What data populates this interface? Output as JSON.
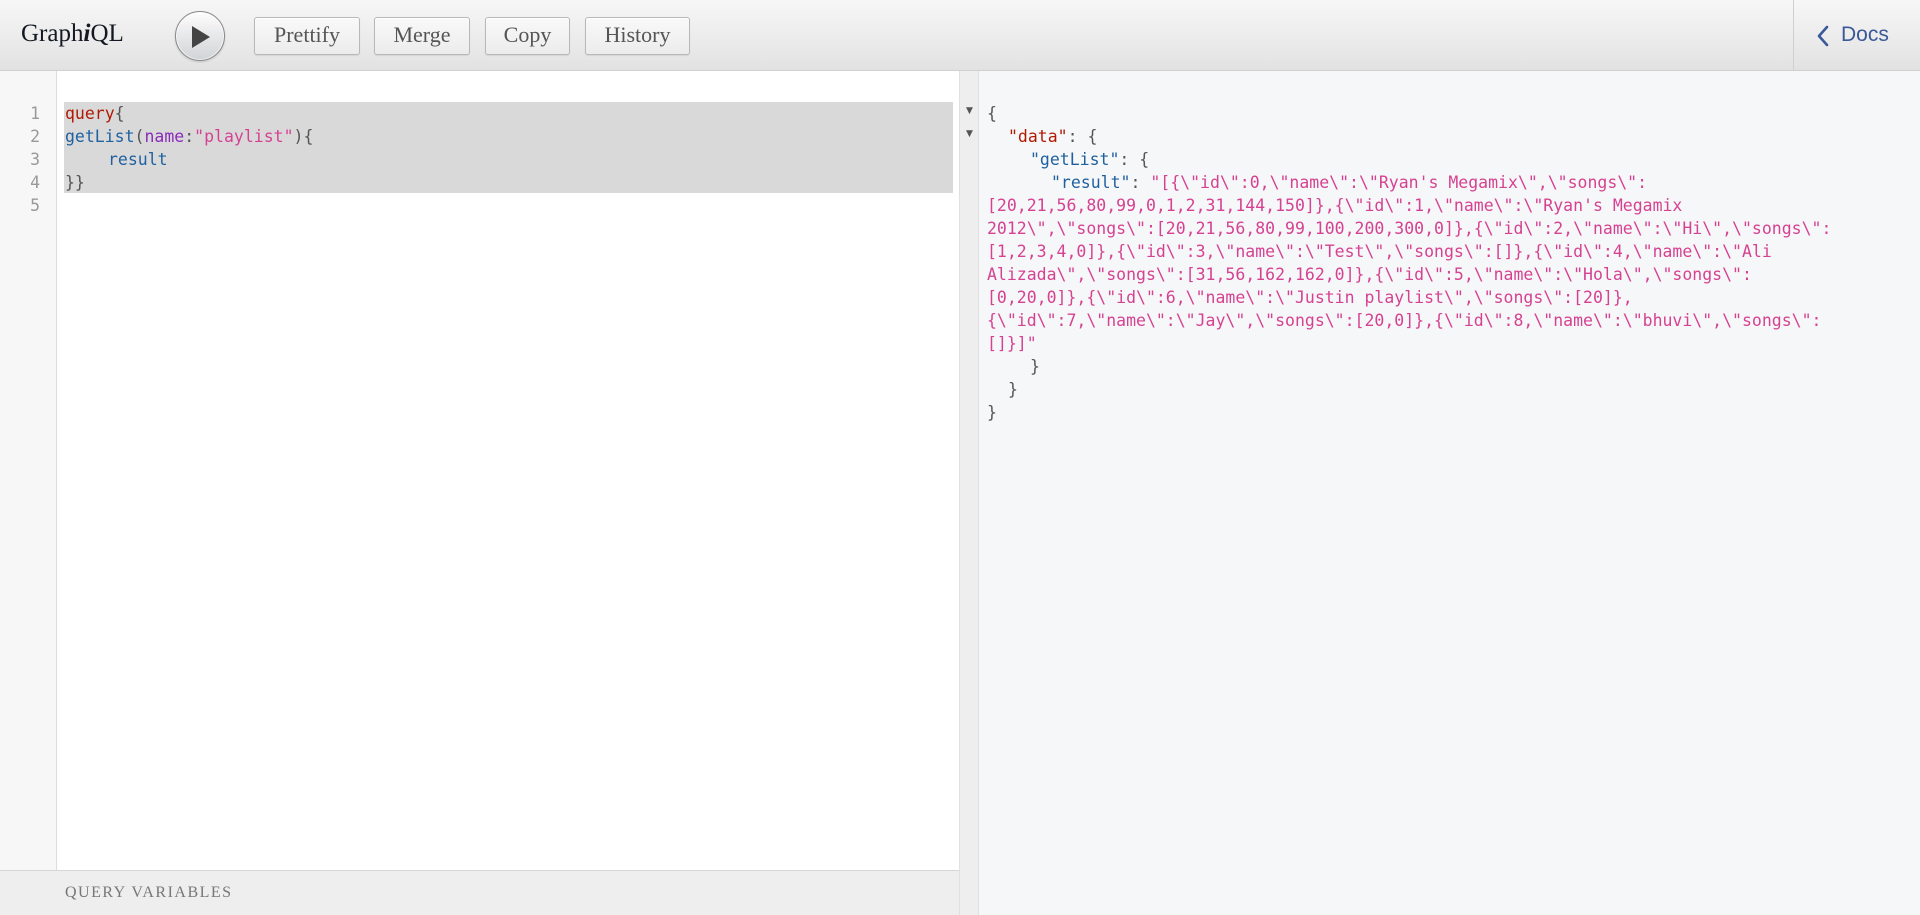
{
  "toolbar": {
    "title_prefix": "Graph",
    "title_italic": "i",
    "title_suffix": "QL",
    "buttons": [
      "Prettify",
      "Merge",
      "Copy",
      "History"
    ],
    "docs_label": "Docs"
  },
  "editor": {
    "line_numbers": [
      "1",
      "2",
      "3",
      "4",
      "5"
    ],
    "line1": {
      "keyword": "query",
      "brace": "{"
    },
    "line2": {
      "field": "getList",
      "open_paren": "(",
      "arg": "name",
      "colon": ":",
      "string": "\"playlist\"",
      "close": "){"
    },
    "line3": {
      "field": "result"
    },
    "line4": {
      "brace": "}}"
    }
  },
  "variables": {
    "title": "Query Variables"
  },
  "result": {
    "open_brace": "{",
    "data_key": "\"data\"",
    "getlist_key": "\"getList\"",
    "result_key": "\"result\"",
    "value_lines": [
      "\"[{\\\"id\\\":0,\\\"name\\\":\\\"Ryan's Megamix\\\",\\\"songs\\\":",
      "[20,21,56,80,99,0,1,2,31,144,150]},{\\\"id\\\":1,\\\"name\\\":\\\"Ryan's Megamix",
      "2012\\\",\\\"songs\\\":[20,21,56,80,99,100,200,300,0]},{\\\"id\\\":2,\\\"name\\\":\\\"Hi\\\",\\\"songs\\\":",
      "[1,2,3,4,0]},{\\\"id\\\":3,\\\"name\\\":\\\"Test\\\",\\\"songs\\\":[]},{\\\"id\\\":4,\\\"name\\\":\\\"Ali",
      "Alizada\\\",\\\"songs\\\":[31,56,162,162,0]},{\\\"id\\\":5,\\\"name\\\":\\\"Hola\\\",\\\"songs\\\":",
      "[0,20,0]},{\\\"id\\\":6,\\\"name\\\":\\\"Justin playlist\\\",\\\"songs\\\":[20]},",
      "{\\\"id\\\":7,\\\"name\\\":\\\"Jay\\\",\\\"songs\\\":[20,0]},{\\\"id\\\":8,\\\"name\\\":\\\"bhuvi\\\",\\\"songs\\\":",
      "[]}]\""
    ],
    "close_getlist": "}",
    "close_data": "}",
    "close_root": "}"
  },
  "colors": {
    "keyword": "#b11a04",
    "field": "#1f61a0",
    "argument": "#8b2bb9",
    "string": "#d64292",
    "docs_link": "#3b5998"
  },
  "icons": {
    "execute": "play-icon",
    "docs": "chevron-left-icon",
    "fold": "fold-arrow-icon"
  }
}
